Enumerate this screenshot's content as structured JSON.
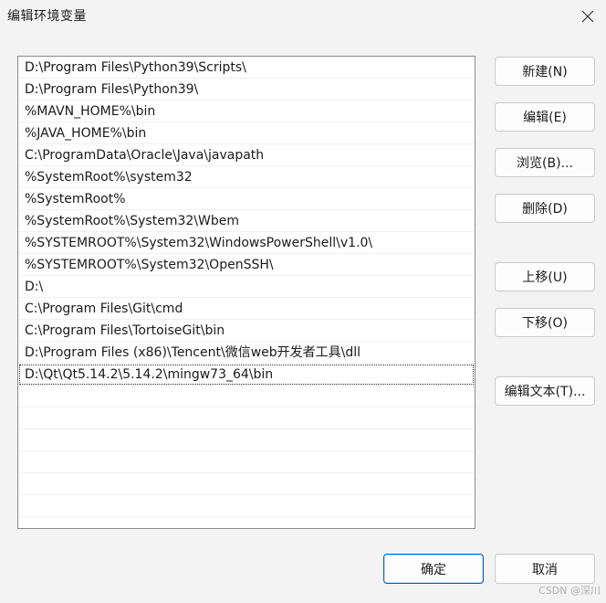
{
  "window": {
    "title": "编辑环境变量",
    "close_icon": "close-icon"
  },
  "path_list": {
    "items": [
      "D:\\Program Files\\Python39\\Scripts\\",
      "D:\\Program Files\\Python39\\",
      "%MAVN_HOME%\\bin",
      "%JAVA_HOME%\\bin",
      "C:\\ProgramData\\Oracle\\Java\\javapath",
      "%SystemRoot%\\system32",
      "%SystemRoot%",
      "%SystemRoot%\\System32\\Wbem",
      "%SYSTEMROOT%\\System32\\WindowsPowerShell\\v1.0\\",
      "%SYSTEMROOT%\\System32\\OpenSSH\\",
      "D:\\",
      "C:\\Program Files\\Git\\cmd",
      "C:\\Program Files\\TortoiseGit\\bin",
      "D:\\Program Files (x86)\\Tencent\\微信web开发者工具\\dll",
      "D:\\Qt\\Qt5.14.2\\5.14.2\\mingw73_64\\bin"
    ],
    "selected_index": 14
  },
  "buttons": {
    "new": "新建(N)",
    "edit": "编辑(E)",
    "browse": "浏览(B)...",
    "delete": "删除(D)",
    "move_up": "上移(U)",
    "move_down": "下移(O)",
    "edit_text": "编辑文本(T)...",
    "ok": "确定",
    "cancel": "取消"
  },
  "watermark": "CSDN @深川",
  "colors": {
    "accent": "#005fb8",
    "background": "#f3f3f3"
  }
}
